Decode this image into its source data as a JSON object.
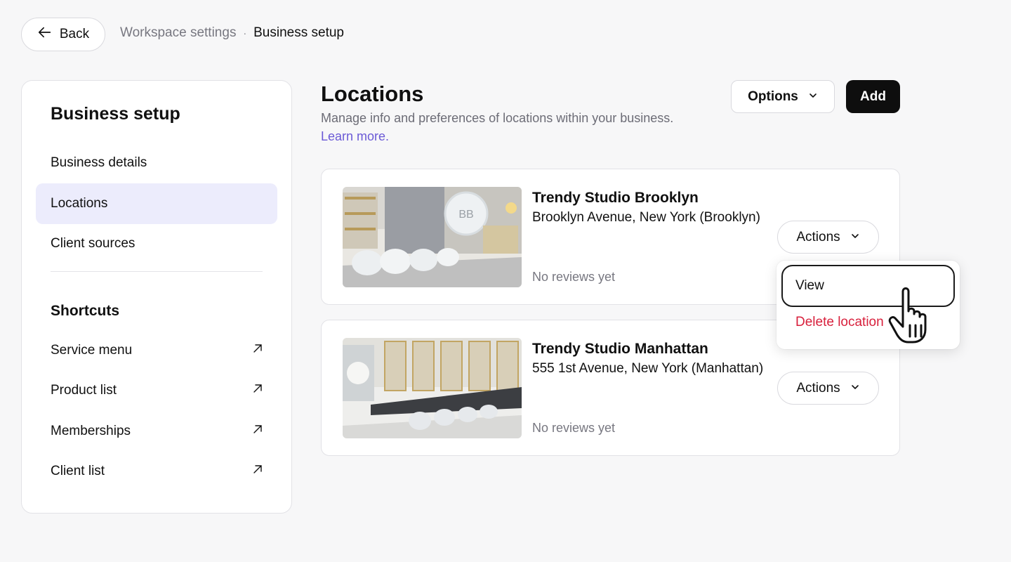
{
  "topbar": {
    "back_label": "Back",
    "breadcrumb": [
      "Workspace settings",
      "Business setup"
    ],
    "breadcrumb_separator": "·"
  },
  "sidebar": {
    "title": "Business setup",
    "items": [
      {
        "label": "Business details",
        "active": false
      },
      {
        "label": "Locations",
        "active": true
      },
      {
        "label": "Client sources",
        "active": false
      }
    ],
    "shortcuts_title": "Shortcuts",
    "shortcuts": [
      {
        "label": "Service menu",
        "icon": "arrow-up-right-icon"
      },
      {
        "label": "Product list",
        "icon": "arrow-up-right-icon"
      },
      {
        "label": "Memberships",
        "icon": "arrow-up-right-icon"
      },
      {
        "label": "Client list",
        "icon": "arrow-up-right-icon"
      }
    ]
  },
  "main": {
    "title": "Locations",
    "subtitle": "Manage info and preferences of locations within your business.",
    "learn_more": "Learn more.",
    "options_label": "Options",
    "add_label": "Add",
    "locations": [
      {
        "name": "Trendy Studio Brooklyn",
        "address": "Brooklyn Avenue, New York (Brooklyn)",
        "reviews": "No reviews yet",
        "actions_label": "Actions"
      },
      {
        "name": "Trendy Studio Manhattan",
        "address": "555 1st Avenue, New York (Manhattan)",
        "reviews": "No reviews yet",
        "actions_label": "Actions"
      }
    ]
  },
  "dropdown": {
    "items": [
      "View",
      "Delete location"
    ]
  },
  "colors": {
    "accent_link": "#6b5ad6",
    "active_nav_bg": "#ececfc",
    "danger": "#d8203c",
    "primary_button": "#0e0e0e"
  }
}
